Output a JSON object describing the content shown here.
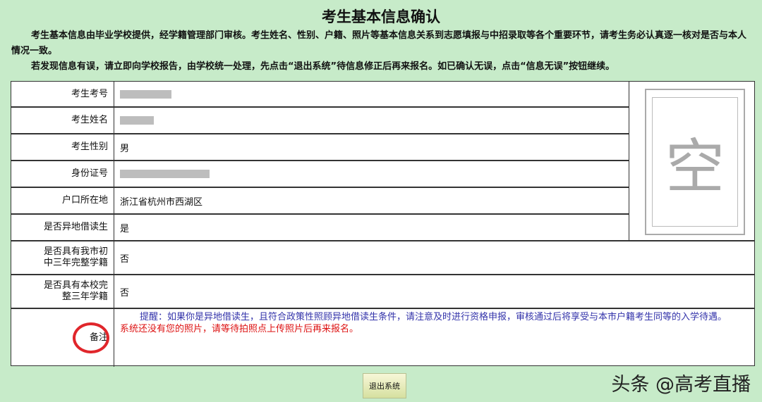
{
  "title": "考生基本信息确认",
  "intro": [
    "考生基本信息由毕业学校提供，经学籍管理部门审核。考生姓名、性别、户籍、照片等基本信息关系到志愿填报与中招录取等各个重要环节，请考生务必认真逐一核对是否与本人情况一致。",
    "若发现信息有误，请立即向学校报告，由学校统一处理，先点击“退出系统”待信息修正后再来报名。如已确认无误，点击“信息无误”按钮继续。"
  ],
  "rows": [
    {
      "label": "考生考号",
      "value": ""
    },
    {
      "label": "考生姓名",
      "value": ""
    },
    {
      "label": "考生性别",
      "value": "男"
    },
    {
      "label": "身份证号",
      "value": ""
    },
    {
      "label": "户口所在地",
      "value": "浙江省杭州市西湖区"
    },
    {
      "label": "是否异地借读生",
      "value": "是"
    },
    {
      "label": "是否具有我市初中三年完整学籍",
      "value": "否"
    },
    {
      "label": "是否具有本校完整三年学籍",
      "value": "否"
    }
  ],
  "photo_placeholder": "空",
  "remarks": {
    "label": "备注",
    "reminder": "提醒：如果你是异地借读生，且符合政策性照顾异地借读生条件，请注意及时进行资格申报，审核通过后将享受与本市户籍考生同等的入学待遇。",
    "warning": "系统还没有您的照片，请等待拍照点上传照片后再来报名。"
  },
  "exit_button": "退出系统",
  "watermark": "头条 @高考直播"
}
